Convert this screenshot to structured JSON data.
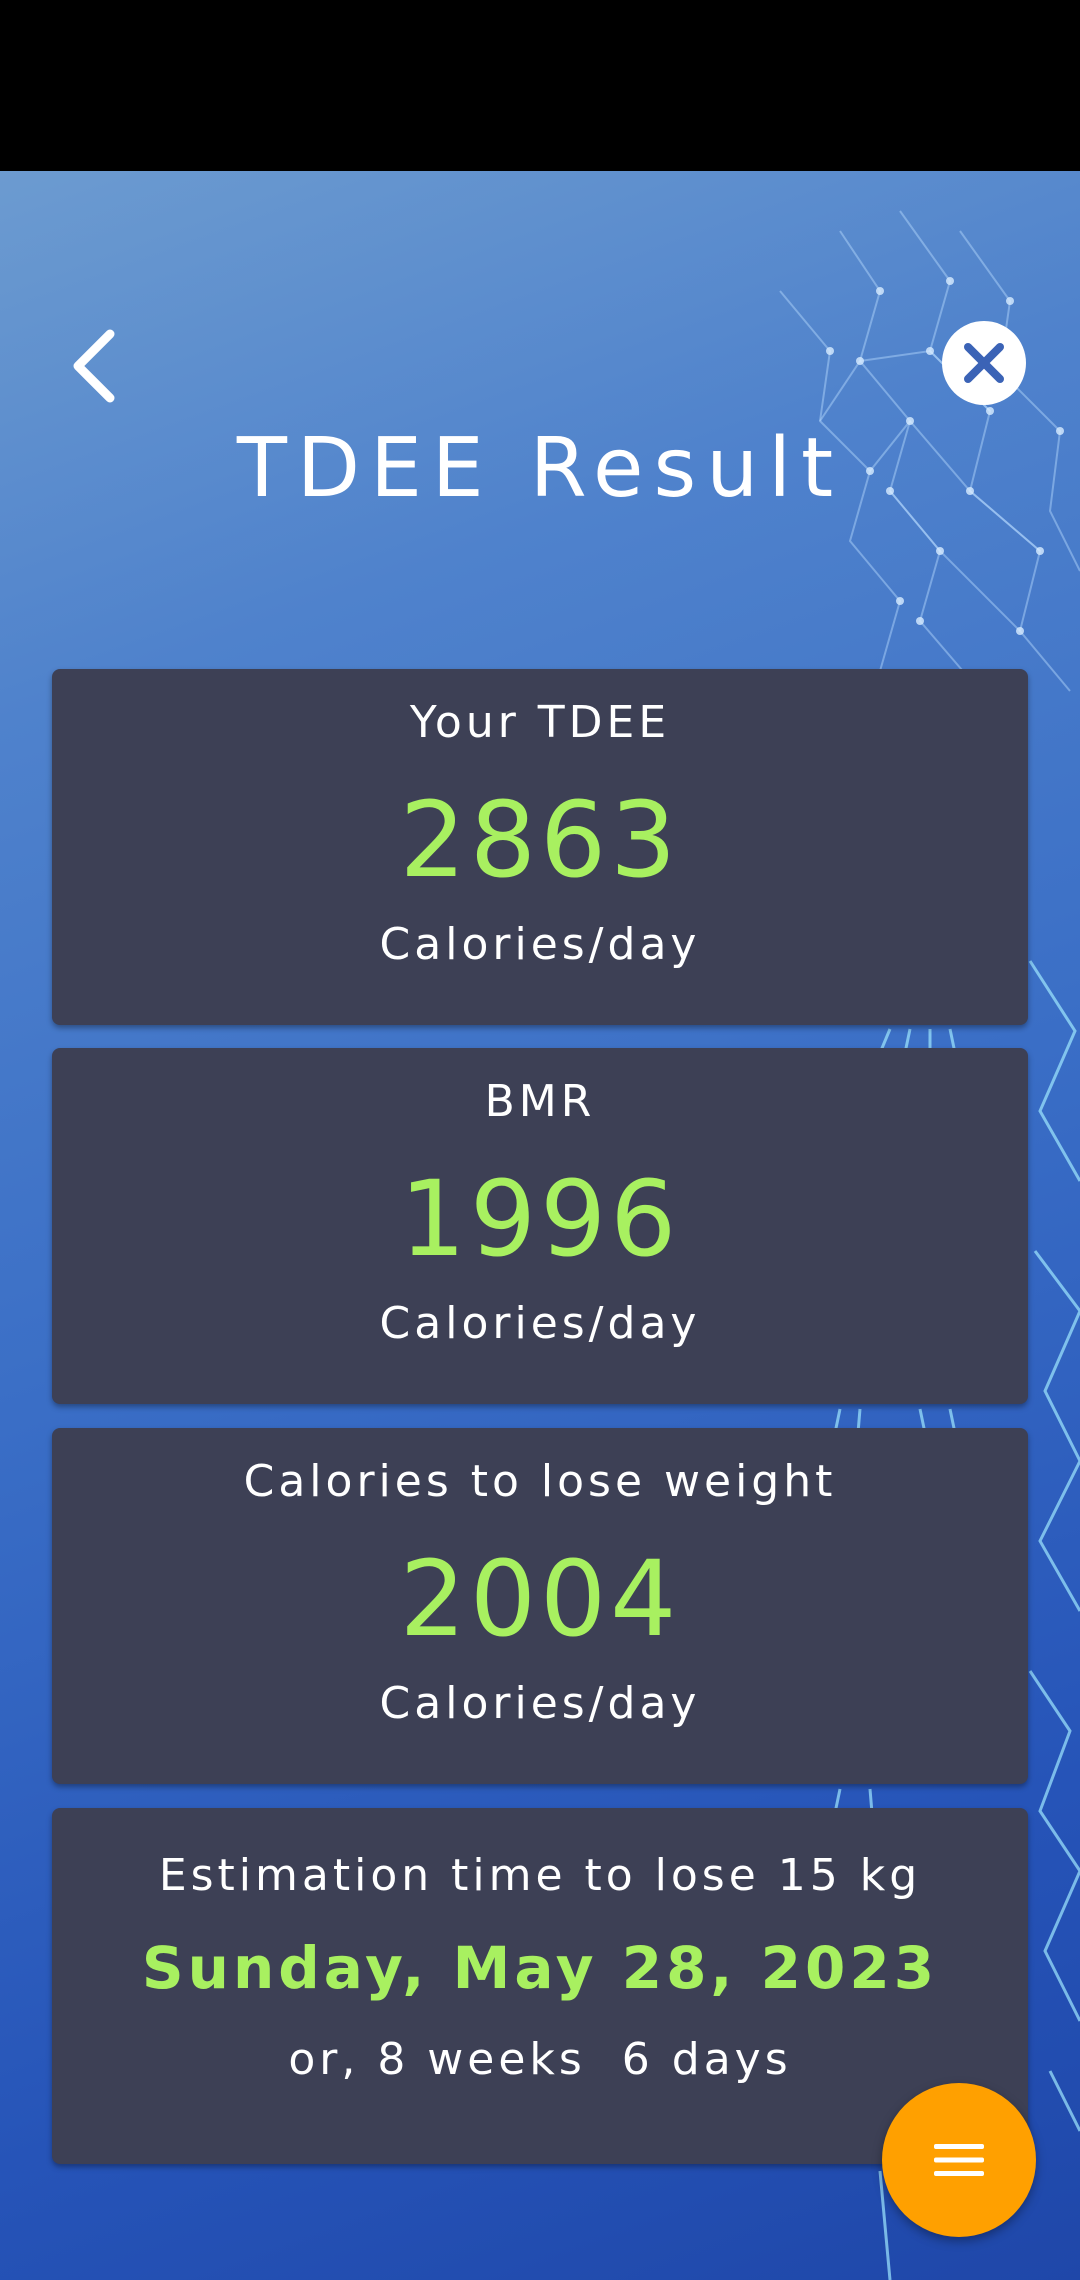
{
  "header": {
    "title": "TDEE Result",
    "back_icon": "chevron-left-icon",
    "close_icon": "close-icon"
  },
  "results": {
    "tdee": {
      "label": "Your TDEE",
      "value": "2863",
      "unit": "Calories/day"
    },
    "bmr": {
      "label": "BMR",
      "value": "1996",
      "unit": "Calories/day"
    },
    "lose_weight": {
      "label": "Calories to lose weight",
      "value": "2004",
      "unit": "Calories/day"
    },
    "estimation": {
      "label": "Estimation time to lose 15 kg",
      "date": "Sunday, May 28, 2023",
      "duration": "or, 8 weeks  6 days"
    }
  },
  "fab": {
    "icon": "menu-icon"
  },
  "colors": {
    "accent_value": "#a8f060",
    "card_background": "#3d4055",
    "fab": "#ffa000"
  }
}
